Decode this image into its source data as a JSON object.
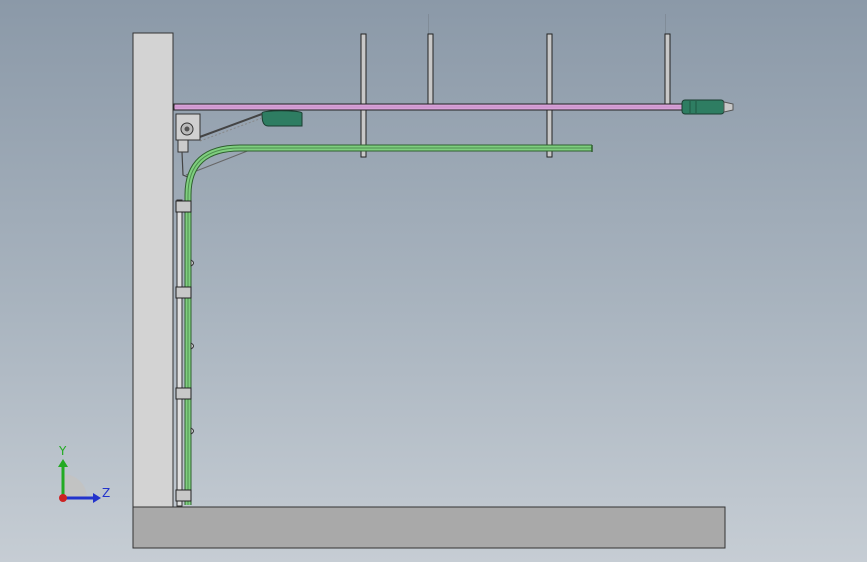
{
  "viewport": {
    "background_top": "#8b99a8",
    "background_bottom": "#c6cdd4"
  },
  "model": {
    "components": [
      "wall",
      "floor-slab",
      "ceiling-hangers",
      "opener-rail",
      "opener-motor",
      "door-track",
      "door-sections",
      "torsion-spring",
      "track-brackets"
    ],
    "colors": {
      "wall": "#d3d3d3",
      "floor": "#a9a9a9",
      "rail": "#d8a2d8",
      "track": "#7fcf7f",
      "motor": "#2e7d62",
      "hanger": "#c8c8c8"
    }
  },
  "triad": {
    "y_label": "Y",
    "z_label": "Z",
    "y_color": "#22aa22",
    "z_color": "#2233cc",
    "x_color": "#cc2222"
  }
}
